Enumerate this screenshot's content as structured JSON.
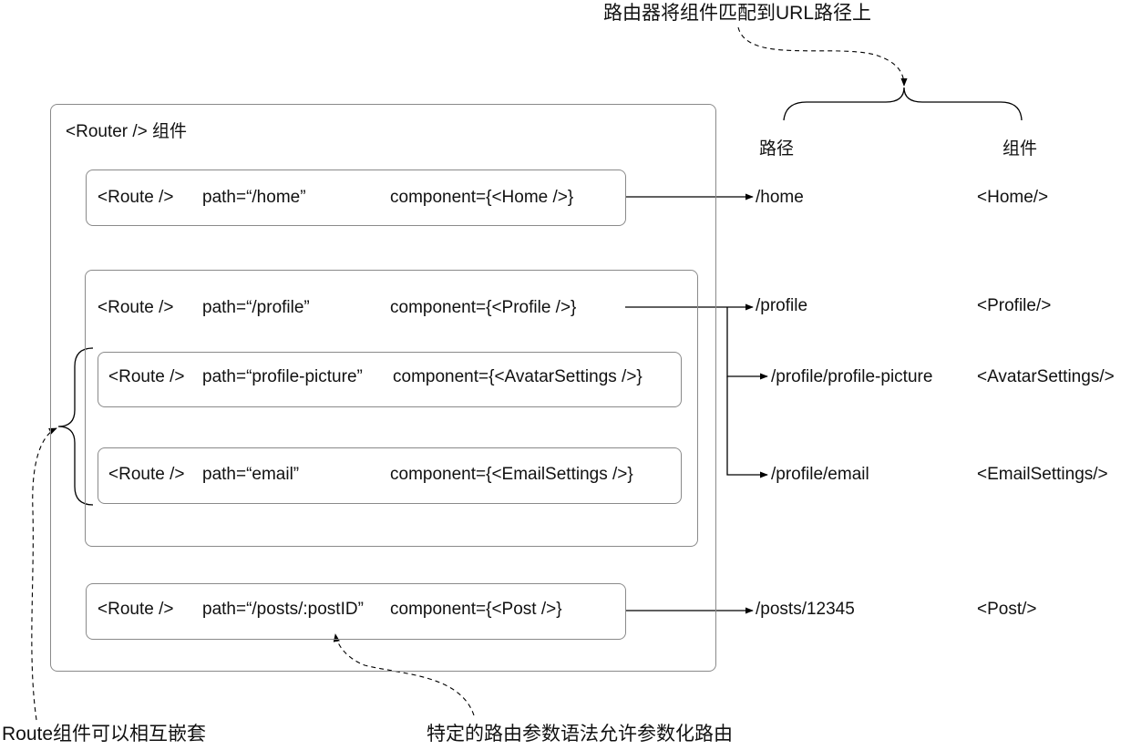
{
  "top_annotation": "路由器将组件匹配到URL路径上",
  "router_label": "<Router /> 组件",
  "headers": {
    "path": "路径",
    "component": "组件"
  },
  "routes": [
    {
      "tag": "<Route />",
      "path": "path=“/home”",
      "component": "component={<Home />}"
    },
    {
      "tag": "<Route />",
      "path": "path=“/profile”",
      "component": "component={<Profile />}"
    },
    {
      "tag": "<Route />",
      "path": "path=“profile-picture”",
      "component": "component={<AvatarSettings />}"
    },
    {
      "tag": "<Route />",
      "path": "path=“email”",
      "component": "component={<EmailSettings />}"
    },
    {
      "tag": "<Route />",
      "path": "path=“/posts/:postID”",
      "component": "component={<Post />}"
    }
  ],
  "table": [
    {
      "url": "/home",
      "component": "<Home/>"
    },
    {
      "url": "/profile",
      "component": "<Profile/>"
    },
    {
      "url": "/profile/profile-picture",
      "component": "<AvatarSettings/>"
    },
    {
      "url": "/profile/email",
      "component": "<EmailSettings/>"
    },
    {
      "url": "/posts/12345",
      "component": "<Post/>"
    }
  ],
  "bottom_left_annotation": "Route组件可以相互嵌套",
  "bottom_right_annotation": "特定的路由参数语法允许参数化路由"
}
